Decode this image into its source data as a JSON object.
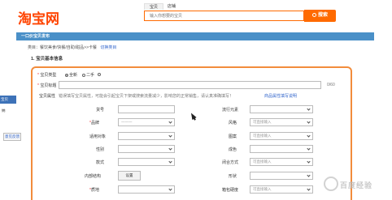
{
  "header": {
    "logo": "淘宝网",
    "tabs": [
      "宝贝",
      "店铺"
    ],
    "search_placeholder": "输入你想要的宝贝",
    "search_button": "搜索"
  },
  "publish_bar": "一口价宝贝发布",
  "category": {
    "path": "类目：餐饮美食/快餐/自助/甜品>>卡餐",
    "edit_link": "切换类目"
  },
  "section_title": "1. 宝贝基本信息",
  "sidebar": {
    "item_a": "宝贝",
    "item_b": "纳",
    "feedback": "意见反馈"
  },
  "form": {
    "type_label": "宝贝类型",
    "type_options": [
      "全新",
      "二手"
    ],
    "title_label": "宝贝标题",
    "title_counter": "0/60",
    "attr_label": "宝贝属性",
    "attr_hint": "错误填写宝贝属性，可能会引起宝贝下架或搜索流量减少，影响您的正常销售，请认真准确填写！",
    "attr_link": "商品属性填写说明",
    "left_fields": [
      {
        "label": "货号",
        "required": false,
        "kind": "input",
        "value": ""
      },
      {
        "label": "品牌",
        "required": true,
        "kind": "select",
        "value": "一一一"
      },
      {
        "label": "适用对象",
        "required": false,
        "kind": "select",
        "value": ""
      },
      {
        "label": "性别",
        "required": false,
        "kind": "select",
        "value": ""
      },
      {
        "label": "款式",
        "required": false,
        "kind": "select",
        "value": ""
      },
      {
        "label": "内部结构",
        "required": false,
        "kind": "button",
        "value": "设置"
      },
      {
        "label": "质地",
        "required": true,
        "kind": "select",
        "value": ""
      }
    ],
    "right_fields": [
      {
        "label": "流行元素",
        "kind": "select",
        "value": ""
      },
      {
        "label": "风格",
        "kind": "select",
        "value": "可直接输入"
      },
      {
        "label": "图案",
        "kind": "select",
        "value": "可直接输入"
      },
      {
        "label": "成色",
        "kind": "select",
        "value": ""
      },
      {
        "label": "闭合方式",
        "kind": "select",
        "value": "可直接输入"
      },
      {
        "label": "形状",
        "kind": "select",
        "value": ""
      },
      {
        "label": "箱包硬度",
        "kind": "select",
        "value": "可直接输入"
      }
    ]
  },
  "watermark": "百度经验",
  "icons": {
    "search": "magnifier-icon",
    "dropdown": "chevron-down-icon",
    "cursor": "mouse-pointer-icon"
  },
  "colors": {
    "brand_orange": "#ff4400",
    "panel_border": "#f28c3c",
    "bar_blue": "#4a90c8",
    "link_blue": "#3366cc"
  }
}
